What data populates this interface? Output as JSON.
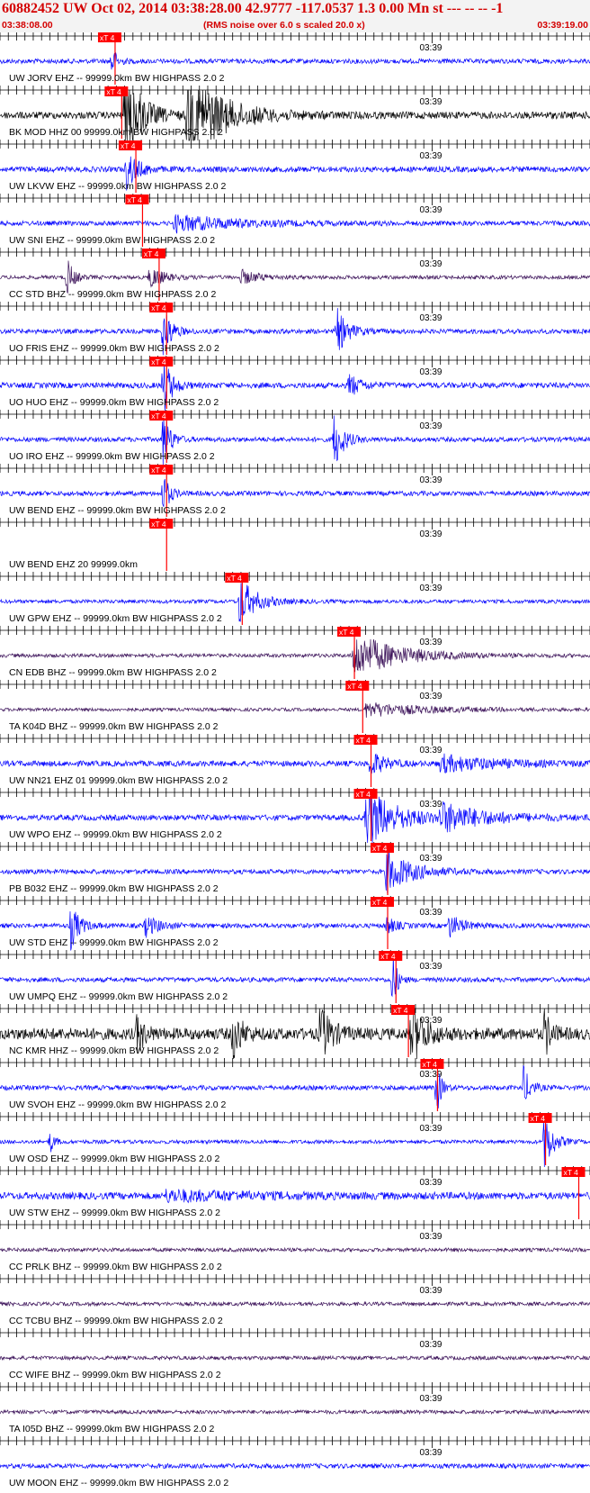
{
  "header": {
    "title": "60882452 UW Oct 02, 2014 03:38:28.00   42.9777 -117.0537  1.3 0.00 Mn st --- -- --  -1",
    "start_time": "03:38:08.00",
    "note": "(RMS noise over 6.0 s scaled 20.0 x)",
    "end_time": "03:39:19.00"
  },
  "chart_data": {
    "type": "line",
    "time_start": "03:38:08.00",
    "time_end": "03:39:19.00",
    "duration_s": 71,
    "tick_interval_s": 1,
    "minute_label": "03:39",
    "minute_mark_s": 52,
    "pick_label": "xT 4",
    "colors": {
      "blue": "#0000ff",
      "black": "#000000",
      "purple": "#3a1058",
      "pick": "#ff0000",
      "title": "#d40000"
    },
    "traces": [
      {
        "label": "UW JORV EHZ -- 99999.0km BW  HIGHPASS  2.0  2",
        "color": "blue",
        "pick_s": 13.2,
        "noise": 0.1,
        "events": [
          [
            13.4,
            0.7,
            1.2
          ]
        ]
      },
      {
        "label": "BK MOD HHZ 00 99999.0km BW  HIGHPASS  2.0  2",
        "color": "black",
        "pick_s": 14.0,
        "noise": 0.15,
        "events": [
          [
            15.0,
            2.5,
            3.5
          ],
          [
            22.5,
            2.0,
            8.0
          ]
        ]
      },
      {
        "label": "UW LKVW EHZ -- 99999.0km BW  HIGHPASS  2.0  2",
        "color": "blue",
        "pick_s": 15.7,
        "noise": 0.12,
        "events": [
          [
            15.2,
            0.9,
            2.5
          ]
        ]
      },
      {
        "label": "UW SNI EHZ -- 99999.0km BW  HIGHPASS  2.0  2",
        "color": "blue",
        "pick_s": 16.5,
        "noise": 0.1,
        "events": [
          [
            21.0,
            0.35,
            14.0
          ]
        ]
      },
      {
        "label": "CC STD BHZ -- 99999.0km BW  HIGHPASS  2.0  2",
        "color": "purple",
        "pick_s": 18.5,
        "noise": 0.08,
        "events": [
          [
            8.0,
            0.9,
            1.5
          ],
          [
            18.0,
            0.5,
            3.0
          ],
          [
            29.0,
            0.3,
            4.0
          ]
        ]
      },
      {
        "label": "UO FRIS EHZ -- 99999.0km BW  HIGHPASS  2.0  2",
        "color": "blue",
        "pick_s": 19.4,
        "noise": 0.1,
        "events": [
          [
            19.6,
            1.2,
            1.8
          ],
          [
            40.5,
            1.0,
            2.5
          ]
        ]
      },
      {
        "label": "UO HUO EHZ -- 99999.0km BW  HIGHPASS  2.0  2",
        "color": "blue",
        "pick_s": 19.4,
        "noise": 0.12,
        "events": [
          [
            19.6,
            1.4,
            1.8
          ],
          [
            42.0,
            0.5,
            2.5
          ]
        ]
      },
      {
        "label": "UO IRO EHZ -- 99999.0km BW  HIGHPASS  2.0  2",
        "color": "blue",
        "pick_s": 19.4,
        "noise": 0.1,
        "events": [
          [
            19.6,
            1.5,
            1.5
          ],
          [
            40.2,
            1.3,
            2.0
          ]
        ]
      },
      {
        "label": "UW BEND EHZ -- 99999.0km BW  HIGHPASS  2.0  2",
        "color": "blue",
        "pick_s": 19.4,
        "noise": 0.1,
        "events": [
          [
            19.6,
            0.9,
            1.5
          ]
        ]
      },
      {
        "label": "UW BEND EHZ 20 99999.0km",
        "color": "blue",
        "pick_s": 19.4,
        "noise": 0.0,
        "events": []
      },
      {
        "label": "UW GPW EHZ -- 99999.0km BW  HIGHPASS  2.0  2",
        "color": "blue",
        "pick_s": 28.5,
        "noise": 0.08,
        "events": [
          [
            28.8,
            1.0,
            4.0
          ]
        ]
      },
      {
        "label": "CN EDB BHZ -- 99999.0km BW  HIGHPASS  2.0  2",
        "color": "purple",
        "pick_s": 42.0,
        "noise": 0.08,
        "events": [
          [
            42.5,
            1.0,
            10.0
          ]
        ]
      },
      {
        "label": "TA K04D BHZ -- 99999.0km BW  HIGHPASS  2.0  2",
        "color": "purple",
        "pick_s": 43.0,
        "noise": 0.07,
        "events": [
          [
            44.0,
            0.3,
            14.0
          ]
        ]
      },
      {
        "label": "UW NN21 EHZ 01 99999.0km BW  HIGHPASS  2.0  2",
        "color": "blue",
        "pick_s": 44.0,
        "noise": 0.12,
        "events": [
          [
            44.5,
            0.6,
            3.0
          ],
          [
            53.0,
            0.35,
            12.0
          ]
        ]
      },
      {
        "label": "UW WPO EHZ -- 99999.0km BW  HIGHPASS  2.0  2",
        "color": "blue",
        "pick_s": 44.0,
        "noise": 0.12,
        "events": [
          [
            44.0,
            1.3,
            7.0
          ],
          [
            53.0,
            0.6,
            10.0
          ]
        ]
      },
      {
        "label": "PB B032 EHZ -- 99999.0km BW  HIGHPASS  2.0  2",
        "color": "blue",
        "pick_s": 46.0,
        "noise": 0.1,
        "events": [
          [
            46.5,
            0.9,
            6.0
          ]
        ]
      },
      {
        "label": "UW STD EHZ -- 99999.0km BW  HIGHPASS  2.0  2",
        "color": "blue",
        "pick_s": 46.0,
        "noise": 0.1,
        "events": [
          [
            8.5,
            1.0,
            2.0
          ],
          [
            17.5,
            0.45,
            3.0
          ],
          [
            46.5,
            0.4,
            2.0
          ],
          [
            54.0,
            0.5,
            3.0
          ]
        ]
      },
      {
        "label": "UW UMPQ EHZ -- 99999.0km BW  HIGHPASS  2.0  2",
        "color": "blue",
        "pick_s": 47.0,
        "noise": 0.1,
        "events": [
          [
            47.2,
            1.4,
            1.0
          ]
        ]
      },
      {
        "label": "NC KMR HHZ -- 99999.0km BW  HIGHPASS  2.0  2",
        "color": "black",
        "pick_s": 48.5,
        "noise": 0.25,
        "events": [
          [
            16.5,
            0.9,
            1.5
          ],
          [
            28.0,
            1.1,
            2.0
          ],
          [
            38.5,
            1.2,
            2.5
          ],
          [
            49.5,
            1.4,
            3.0
          ],
          [
            65.5,
            1.0,
            1.5
          ]
        ]
      },
      {
        "label": "UW SVOH EHZ -- 99999.0km BW  HIGHPASS  2.0  2",
        "color": "blue",
        "pick_s": 52.0,
        "noise": 0.1,
        "events": [
          [
            52.5,
            1.3,
            1.0
          ],
          [
            63.0,
            0.9,
            1.5
          ]
        ]
      },
      {
        "label": "UW OSD EHZ -- 99999.0km BW  HIGHPASS  2.0  2",
        "color": "blue",
        "pick_s": 65.0,
        "noise": 0.08,
        "events": [
          [
            6.0,
            0.5,
            1.0
          ],
          [
            65.5,
            1.3,
            2.0
          ]
        ]
      },
      {
        "label": "UW STW EHZ -- 99999.0km BW  HIGHPASS  2.0  2",
        "color": "blue",
        "pick_s": 69.0,
        "noise": 0.15,
        "events": [
          [
            20.0,
            0.2,
            20.0
          ]
        ]
      },
      {
        "label": "CC PRLK BHZ -- 99999.0km BW  HIGHPASS  2.0  2",
        "color": "purple",
        "pick_s": null,
        "noise": 0.08,
        "events": []
      },
      {
        "label": "CC TCBU BHZ -- 99999.0km BW  HIGHPASS  2.0  2",
        "color": "purple",
        "pick_s": null,
        "noise": 0.08,
        "events": []
      },
      {
        "label": "CC WIFE BHZ -- 99999.0km BW  HIGHPASS  2.0  2",
        "color": "purple",
        "pick_s": null,
        "noise": 0.08,
        "events": []
      },
      {
        "label": "TA I05D BHZ -- 99999.0km BW  HIGHPASS  2.0  2",
        "color": "purple",
        "pick_s": null,
        "noise": 0.08,
        "events": []
      },
      {
        "label": "UW MOON EHZ -- 99999.0km BW  HIGHPASS  2.0  2",
        "color": "blue",
        "pick_s": null,
        "noise": 0.1,
        "events": []
      }
    ]
  }
}
